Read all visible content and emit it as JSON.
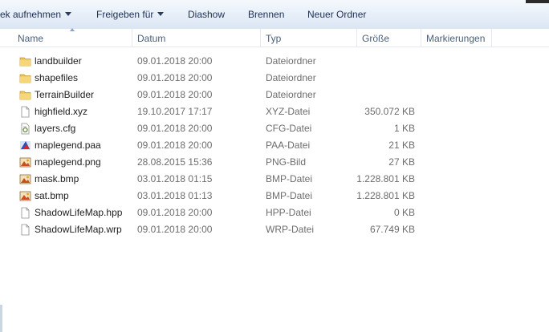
{
  "toolbar": {
    "items": [
      {
        "label": "ek aufnehmen",
        "dropdown": true
      },
      {
        "label": "Freigeben für",
        "dropdown": true
      },
      {
        "label": "Diashow",
        "dropdown": false
      },
      {
        "label": "Brennen",
        "dropdown": false
      },
      {
        "label": "Neuer Ordner",
        "dropdown": false
      }
    ]
  },
  "columns": {
    "name": "Name",
    "date": "Datum",
    "type": "Typ",
    "size": "Größe",
    "tags": "Markierungen"
  },
  "files": [
    {
      "name": "landbuilder",
      "date": "09.01.2018 20:00",
      "type": "Dateiordner",
      "size": "",
      "icon": "folder-icon"
    },
    {
      "name": "shapefiles",
      "date": "09.01.2018 20:00",
      "type": "Dateiordner",
      "size": "",
      "icon": "folder-icon"
    },
    {
      "name": "TerrainBuilder",
      "date": "09.01.2018 20:00",
      "type": "Dateiordner",
      "size": "",
      "icon": "folder-icon"
    },
    {
      "name": "highfield.xyz",
      "date": "19.10.2017 17:17",
      "type": "XYZ-Datei",
      "size": "350.072 KB",
      "icon": "document-icon"
    },
    {
      "name": "layers.cfg",
      "date": "09.01.2018 20:00",
      "type": "CFG-Datei",
      "size": "1 KB",
      "icon": "config-file-icon"
    },
    {
      "name": "maplegend.paa",
      "date": "09.01.2018 20:00",
      "type": "PAA-Datei",
      "size": "21 KB",
      "icon": "paa-file-icon"
    },
    {
      "name": "maplegend.png",
      "date": "28.08.2015 15:36",
      "type": "PNG-Bild",
      "size": "27 KB",
      "icon": "image-file-icon"
    },
    {
      "name": "mask.bmp",
      "date": "03.01.2018 01:15",
      "type": "BMP-Datei",
      "size": "1.228.801 KB",
      "icon": "image-file-icon"
    },
    {
      "name": "sat.bmp",
      "date": "03.01.2018 01:13",
      "type": "BMP-Datei",
      "size": "1.228.801 KB",
      "icon": "image-file-icon"
    },
    {
      "name": "ShadowLifeMap.hpp",
      "date": "09.01.2018 20:00",
      "type": "HPP-Datei",
      "size": "0 KB",
      "icon": "document-icon"
    },
    {
      "name": "ShadowLifeMap.wrp",
      "date": "09.01.2018 20:00",
      "type": "WRP-Datei",
      "size": "67.749 KB",
      "icon": "document-icon"
    }
  ]
}
